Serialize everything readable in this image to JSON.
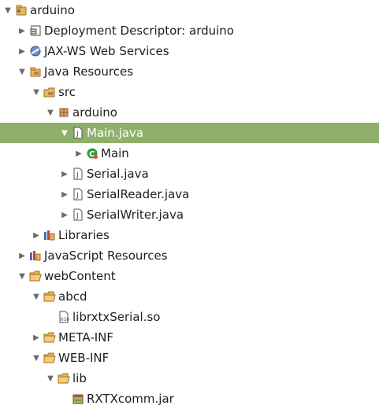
{
  "tree": {
    "items": [
      {
        "label": "arduino",
        "icon": "project-icon",
        "expanded": true
      },
      {
        "label": "Deployment Descriptor: arduino",
        "icon": "deployment-descriptor-icon",
        "expanded": false
      },
      {
        "label": "JAX-WS Web Services",
        "icon": "web-services-icon",
        "expanded": false
      },
      {
        "label": "Java Resources",
        "icon": "java-resources-icon",
        "expanded": true
      },
      {
        "label": "src",
        "icon": "source-folder-icon",
        "expanded": true
      },
      {
        "label": "arduino",
        "icon": "package-icon",
        "expanded": true
      },
      {
        "label": "Main.java",
        "icon": "java-file-icon",
        "expanded": true,
        "selected": true
      },
      {
        "label": "Main",
        "icon": "class-icon",
        "expanded": false
      },
      {
        "label": "Serial.java",
        "icon": "java-file-icon",
        "expanded": false
      },
      {
        "label": "SerialReader.java",
        "icon": "java-file-icon",
        "expanded": false
      },
      {
        "label": "SerialWriter.java",
        "icon": "java-file-icon",
        "expanded": false
      },
      {
        "label": "Libraries",
        "icon": "libraries-icon",
        "expanded": false
      },
      {
        "label": "JavaScript Resources",
        "icon": "libraries-icon",
        "expanded": false
      },
      {
        "label": "webContent",
        "icon": "folder-open-icon",
        "expanded": true
      },
      {
        "label": "abcd",
        "icon": "folder-open-icon",
        "expanded": true
      },
      {
        "label": "librxtxSerial.so",
        "icon": "binary-file-icon"
      },
      {
        "label": "META-INF",
        "icon": "folder-icon",
        "expanded": false
      },
      {
        "label": "WEB-INF",
        "icon": "folder-open-icon",
        "expanded": true
      },
      {
        "label": "lib",
        "icon": "folder-open-icon",
        "expanded": true
      },
      {
        "label": "RXTXcomm.jar",
        "icon": "jar-file-icon"
      }
    ]
  },
  "colors": {
    "selection": "#8fb06a",
    "folder": "#e8b65a",
    "package": "#b8804a",
    "class": "#3a9a3a"
  }
}
